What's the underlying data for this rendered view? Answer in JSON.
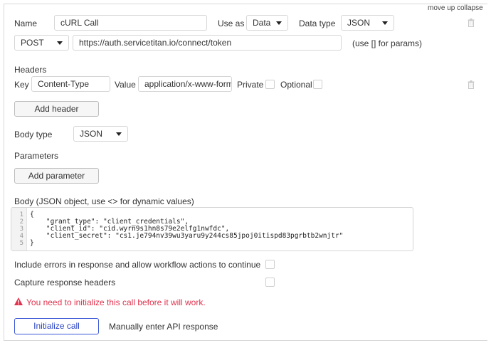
{
  "top_links": {
    "move_up": "move up",
    "collapse": "collapse"
  },
  "call": {
    "name_label": "Name",
    "name_value": "cURL Call",
    "use_as_label": "Use as",
    "use_as_value": "Data",
    "data_type_label": "Data type",
    "data_type_value": "JSON",
    "method_value": "POST",
    "url_value": "https://auth.servicetitan.io/connect/token",
    "params_hint": "(use [] for params)"
  },
  "headers": {
    "section_label": "Headers",
    "key_label": "Key",
    "key_value": "Content-Type",
    "value_label": "Value",
    "value_value": "application/x-www-form-",
    "private_label": "Private",
    "optional_label": "Optional",
    "add_header_label": "Add header"
  },
  "body": {
    "body_type_label": "Body type",
    "body_type_value": "JSON",
    "parameters_label": "Parameters",
    "add_parameter_label": "Add parameter",
    "body_label": "Body (JSON object, use <> for dynamic values)",
    "code_lines": [
      {
        "num": "1",
        "text": "{"
      },
      {
        "num": "2",
        "text": "    \"grant_type\": \"client_credentials\","
      },
      {
        "num": "3",
        "text": "    \"client_id\": \"cid.wyrn9s1hn8s79e2elfg1nwfdc\","
      },
      {
        "num": "4",
        "text": "    \"client_secret\": \"cs1.je794nv39wu3yaru9y244cs85jpoj0itispd83pgrbtb2wnjtr\""
      },
      {
        "num": "5",
        "text": "}"
      }
    ]
  },
  "options": {
    "include_errors_label": "Include errors in response and allow workflow actions to continue",
    "capture_headers_label": "Capture response headers"
  },
  "warning": {
    "text": "You need to initialize this call before it will work.",
    "color": "#e0324d"
  },
  "actions": {
    "initialize_label": "Initialize call",
    "manual_label": "Manually enter API response"
  },
  "colors": {
    "accent": "#3b57d6",
    "border": "#d6d6d6"
  }
}
